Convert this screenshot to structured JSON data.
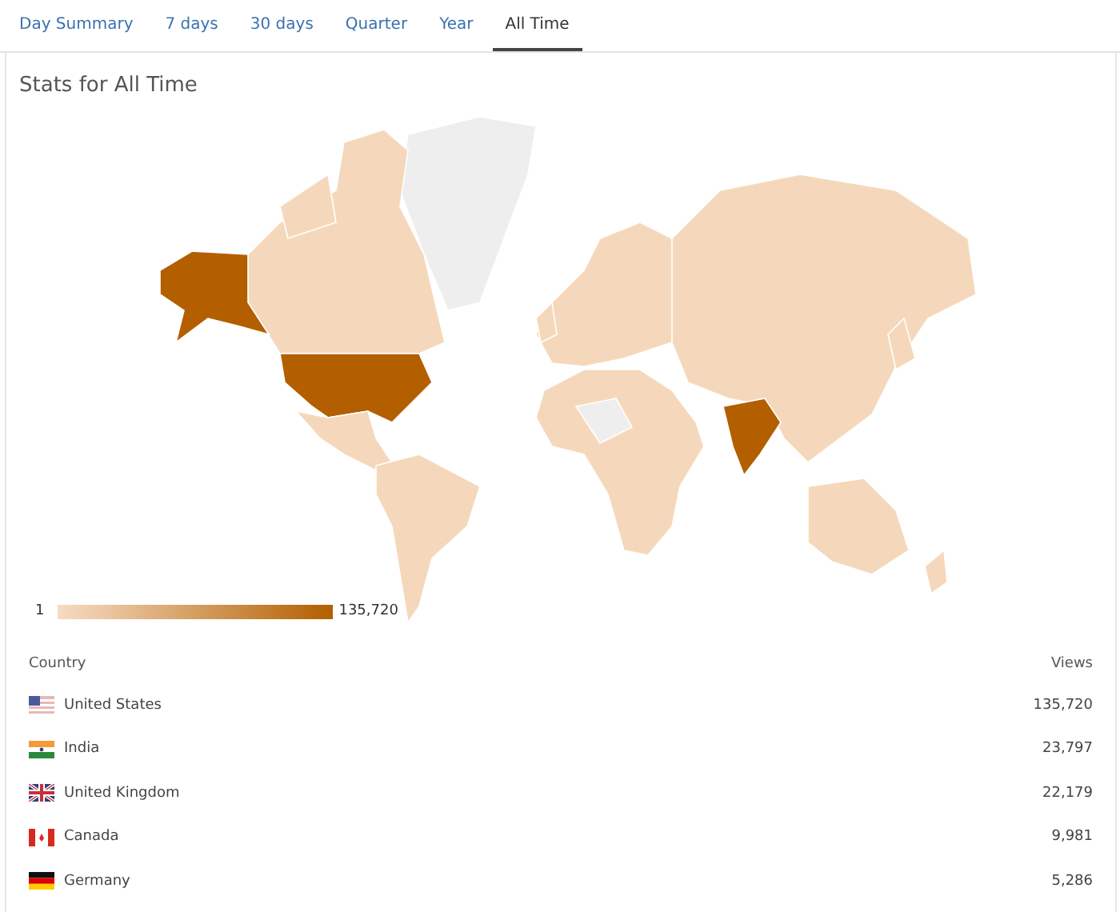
{
  "tabs": [
    {
      "label": "Day Summary",
      "selected": false
    },
    {
      "label": "7 days",
      "selected": false
    },
    {
      "label": "30 days",
      "selected": false
    },
    {
      "label": "Quarter",
      "selected": false
    },
    {
      "label": "Year",
      "selected": false
    },
    {
      "label": "All Time",
      "selected": true
    }
  ],
  "title": "Stats for All Time",
  "legend": {
    "min": "1",
    "max": "135,720"
  },
  "table": {
    "columns": [
      "Country",
      "Views"
    ],
    "rows": [
      {
        "kind": "us",
        "country": "United States",
        "views": "135,720"
      },
      {
        "kind": "india",
        "country": "India",
        "views": "23,797"
      },
      {
        "kind": "uk",
        "country": "United Kingdom",
        "views": "22,179"
      },
      {
        "kind": "canada",
        "country": "Canada",
        "views": "9,981"
      },
      {
        "kind": "germany",
        "country": "Germany",
        "views": "5,286"
      }
    ]
  }
}
